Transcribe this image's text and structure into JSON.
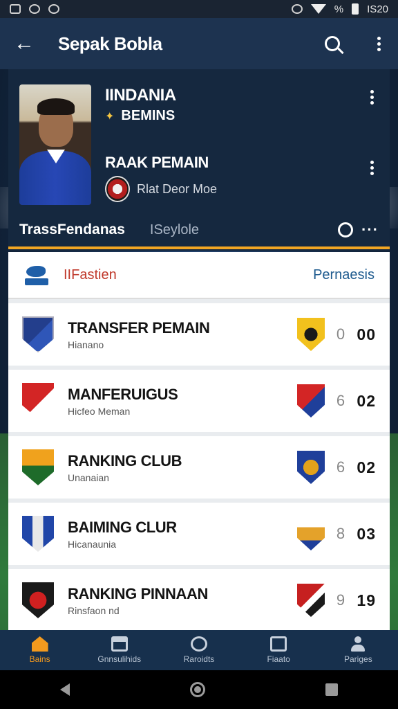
{
  "status_bar": {
    "battery_text": "%",
    "time": "IS20"
  },
  "app_bar": {
    "title": "Sepak Bobla"
  },
  "profile": {
    "name": "IINDANIA",
    "role": "BEMINS",
    "rank_title": "RAAK PEMAIN",
    "club": "Rlat Deor Moe"
  },
  "tabs": {
    "active": "TrassFendanas",
    "inactive": "ISeylole"
  },
  "list_header": {
    "left": "IIFastien",
    "right": "Pernaesis"
  },
  "rows": [
    {
      "title": "TRANSFER PEMAIN",
      "sub": "Hianano",
      "score_a": "0",
      "score_b": "00"
    },
    {
      "title": "MANFERUIGUS",
      "sub": "Hicfeo Meman",
      "score_a": "6",
      "score_b": "02"
    },
    {
      "title": "RANKING CLUB",
      "sub": "Unanaian",
      "score_a": "6",
      "score_b": "02"
    },
    {
      "title": "BAIMING CLUR",
      "sub": "Hicanaunia",
      "score_a": "8",
      "score_b": "03"
    },
    {
      "title": "RANKING PINNAAN",
      "sub": "Rinsfaon nd",
      "score_a": "9",
      "score_b": "19"
    }
  ],
  "bottom_nav": [
    {
      "label": "Bains",
      "icon": "home-icon",
      "active": true
    },
    {
      "label": "Gnnsulihids",
      "icon": "building-icon",
      "active": false
    },
    {
      "label": "Raroidts",
      "icon": "refresh-icon",
      "active": false
    },
    {
      "label": "Fiaato",
      "icon": "card-icon",
      "active": false
    },
    {
      "label": "Pariges",
      "icon": "person-icon",
      "active": false
    }
  ],
  "colors": {
    "app_bar": "#1d3350",
    "accent": "#f2a623",
    "active_nav": "#f39a1e",
    "header_left": "#c0392b",
    "header_right": "#1d5a8e"
  }
}
